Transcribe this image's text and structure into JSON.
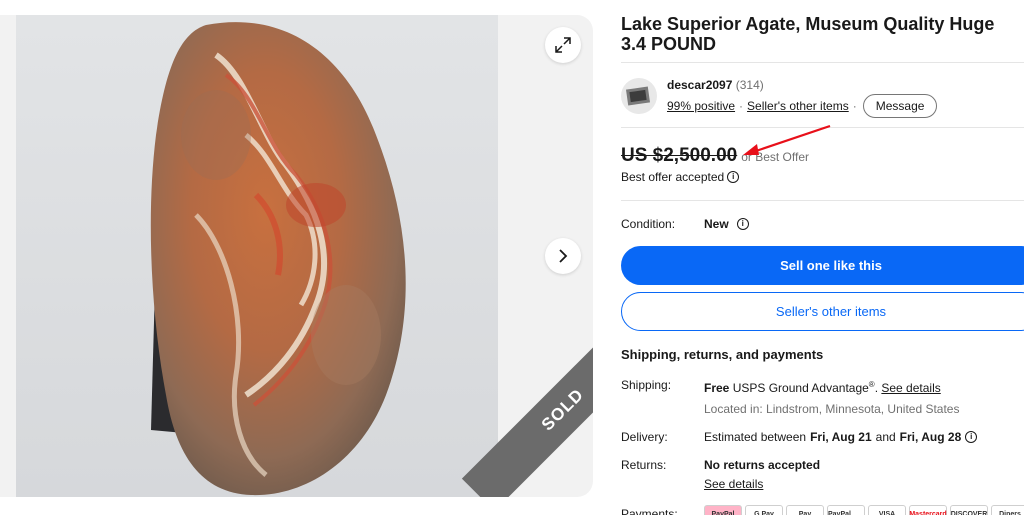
{
  "listing": {
    "title": "Lake Superior Agate, Museum Quality Huge 3.4 POUND",
    "sold_label": "SOLD"
  },
  "seller": {
    "name": "descar2097",
    "feedback_count": "(314)",
    "positive": "99% positive",
    "other_items": "Seller's other items",
    "message_label": "Message"
  },
  "price": {
    "amount": "US $2,500.00",
    "best_offer": "or Best Offer",
    "offer_accepted": "Best offer accepted"
  },
  "condition": {
    "label": "Condition:",
    "value": "New"
  },
  "buttons": {
    "sell_one": "Sell one like this",
    "sellers_other_items": "Seller's other items"
  },
  "shipping_section": {
    "heading": "Shipping, returns, and payments",
    "shipping_label": "Shipping:",
    "shipping_free": "Free",
    "shipping_service": "USPS Ground Advantage",
    "shipping_mark": "®",
    "see_details": "See details",
    "location": "Located in: Lindstrom, Minnesota, United States",
    "delivery_label": "Delivery:",
    "delivery_prefix": "Estimated between",
    "delivery_from": "Fri, Aug 21",
    "delivery_and": "and",
    "delivery_to": "Fri, Aug 28",
    "returns_label": "Returns:",
    "returns_value": "No returns accepted",
    "returns_details": "See details",
    "payments_label": "Payments:"
  },
  "payment_logos": [
    "PayPal",
    "G Pay",
    "Pay",
    "PayPal Credit",
    "VISA",
    "Mastercard",
    "DISCOVER",
    "Diners"
  ],
  "colors": {
    "accent_blue": "#0968f6",
    "sold_ribbon": "#6b6b6b",
    "annotation_arrow": "#e8101a"
  },
  "icons": {
    "expand": "expand-icon",
    "next": "chevron-right-icon",
    "info": "info-icon"
  }
}
